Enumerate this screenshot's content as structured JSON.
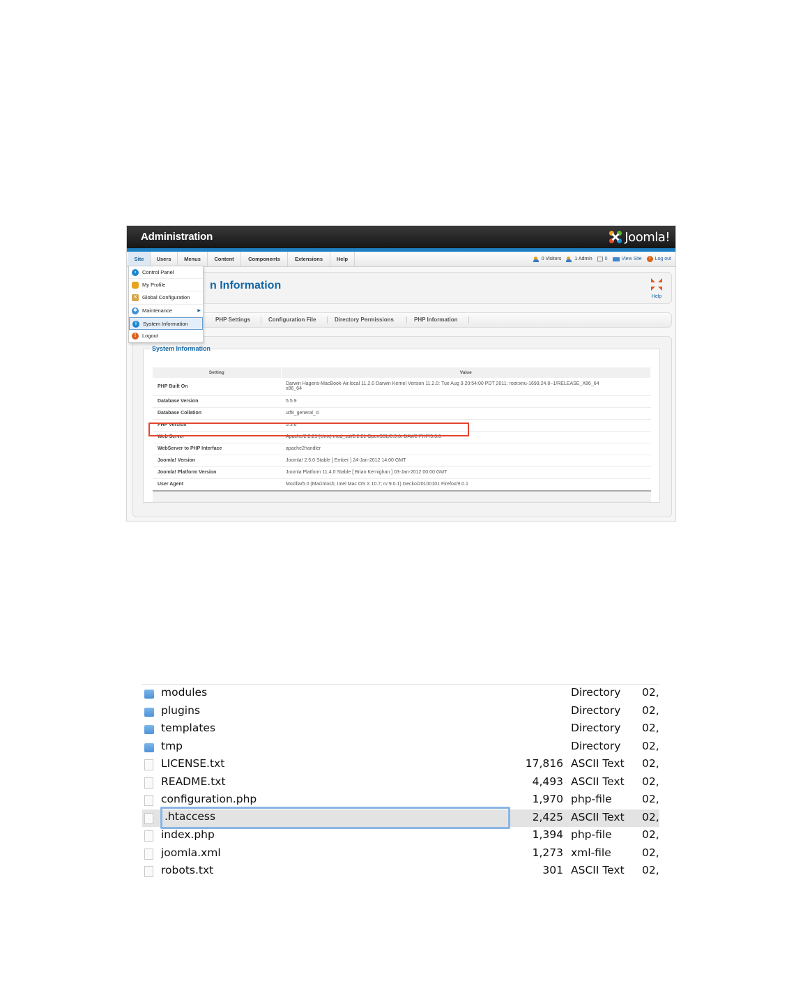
{
  "admin": {
    "title": "Administration",
    "logo_text": "Joomla!",
    "menu": [
      "Site",
      "Users",
      "Menus",
      "Content",
      "Components",
      "Extensions",
      "Help"
    ],
    "status": {
      "visitors": "0 Visitors",
      "admins": "1 Admin",
      "messages": "0",
      "view_site": "View Site",
      "logout": "Log out"
    },
    "page_title_partial": "n Information",
    "help_label": "Help",
    "tabs": [
      "PHP Settings",
      "Configuration File",
      "Directory Permissions",
      "PHP Information"
    ],
    "site_dropdown": {
      "items": [
        {
          "label": "Control Panel",
          "icon": "control-panel-icon"
        },
        {
          "label": "My Profile",
          "icon": "profile-icon"
        },
        {
          "label": "Global Configuration",
          "icon": "config-icon"
        },
        {
          "label": "Maintenance",
          "icon": "maintenance-icon",
          "submenu": true
        },
        {
          "label": "System Information",
          "icon": "info-icon",
          "selected": true
        },
        {
          "label": "Logout",
          "icon": "logout-icon"
        }
      ]
    },
    "system_info": {
      "legend": "System Information",
      "col_setting": "Setting",
      "col_value": "Value",
      "rows": [
        {
          "key": "PHP Built On",
          "value": "Darwin Hagens-MacBook-Air.local 11.2.0 Darwin Kernel Version 11.2.0: Tue Aug 9 20:54:00 PDT 2011; root:xnu-1699.24.8~1/RELEASE_X86_64",
          "value2": "x86_64"
        },
        {
          "key": "Database Version",
          "value": "5.5.9"
        },
        {
          "key": "Database Collation",
          "value": "utf8_general_ci"
        },
        {
          "key": "PHP Version",
          "value": "5.3.6"
        },
        {
          "key": "Web Server",
          "value": "Apache/2.2.21 (Unix) mod_ssl/2.2.21 OpenSSL/0.9.8r DAV/2 PHP/5.3.6"
        },
        {
          "key": "WebServer to PHP Interface",
          "value": "apache2handler"
        },
        {
          "key": "Joomla! Version",
          "value": "Joomla! 2.5.0 Stable [ Ember ] 24-Jan-2012 14:00 GMT"
        },
        {
          "key": "Joomla! Platform Version",
          "value": "Joomla Platform 11.4.0 Stable [ Brian Kernighan ] 03-Jan-2012 00:00 GMT"
        },
        {
          "key": "User Agent",
          "value": "Mozilla/5.0 (Macintosh; Intel Mac OS X 10.7; rv:9.0.1) Gecko/20100101 Firefox/9.0.1"
        }
      ]
    }
  },
  "finder": {
    "rows": [
      {
        "name": "modules",
        "size": "",
        "kind": "Directory",
        "date": "02,",
        "type": "folder"
      },
      {
        "name": "plugins",
        "size": "",
        "kind": "Directory",
        "date": "02,",
        "type": "folder"
      },
      {
        "name": "templates",
        "size": "",
        "kind": "Directory",
        "date": "02,",
        "type": "folder"
      },
      {
        "name": "tmp",
        "size": "",
        "kind": "Directory",
        "date": "02,",
        "type": "folder"
      },
      {
        "name": "LICENSE.txt",
        "size": "17,816",
        "kind": "ASCII Text",
        "date": "02,",
        "type": "file"
      },
      {
        "name": "README.txt",
        "size": "4,493",
        "kind": "ASCII Text",
        "date": "02,",
        "type": "file"
      },
      {
        "name": "configuration.php",
        "size": "1,970",
        "kind": "php-file",
        "date": "02,",
        "type": "file"
      },
      {
        "name": ".htaccess",
        "size": "2,425",
        "kind": "ASCII Text",
        "date": "02,",
        "type": "file",
        "selected": true,
        "editing": true
      },
      {
        "name": "index.php",
        "size": "1,394",
        "kind": "php-file",
        "date": "02,",
        "type": "file"
      },
      {
        "name": "joomla.xml",
        "size": "1,273",
        "kind": "xml-file",
        "date": "02,",
        "type": "file"
      },
      {
        "name": "robots.txt",
        "size": "301",
        "kind": "ASCII Text",
        "date": "02,",
        "type": "file"
      }
    ]
  },
  "colors": {
    "joomla_blue": "#1467a6",
    "highlight_red": "#e3442f",
    "finder_selection": "#e3e3e3"
  }
}
